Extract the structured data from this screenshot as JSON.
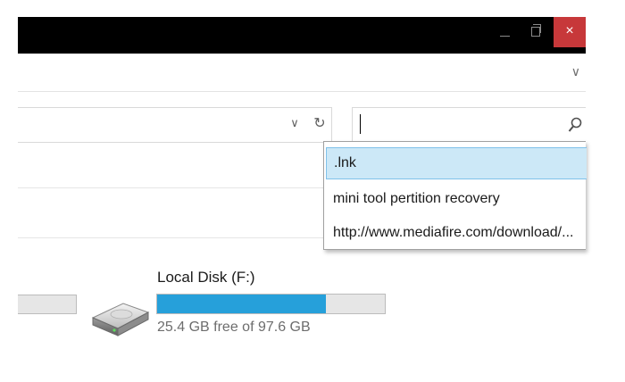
{
  "window": {
    "minimize_glyph": "_",
    "close_glyph": "×"
  },
  "ribbon": {
    "expand_glyph": "∨"
  },
  "address_bar": {
    "value": "",
    "dropdown_glyph": "∨",
    "refresh_glyph": "↻"
  },
  "search": {
    "value": "",
    "placeholder": ""
  },
  "autocomplete": {
    "items": [
      {
        "label": ".lnk",
        "selected": true
      },
      {
        "label": "mini tool pertition recovery",
        "selected": false
      },
      {
        "label": "http://www.mediafire.com/download/...",
        "selected": false
      }
    ]
  },
  "drive": {
    "name": "Local Disk (F:)",
    "free_text": "25.4 GB free of 97.6 GB",
    "used_fraction": 0.74,
    "bar_color": "#26a0da"
  },
  "colors": {
    "titlebar": "#000000",
    "close_button": "#c7383a",
    "selection_bg": "#cce8f7",
    "selection_border": "#7fc1ea"
  },
  "icons": {
    "search": "magnifier-icon",
    "drive": "hard-drive-icon"
  }
}
